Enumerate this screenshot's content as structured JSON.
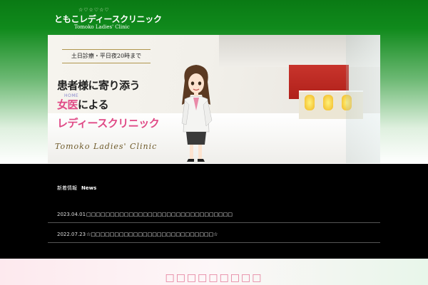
{
  "header": {
    "logo_main": "ともこレディースクリニック",
    "logo_sub": "Tomoko Ladies' Clinic",
    "logo_ornament": "☆♡☆♡☆♡"
  },
  "banner": {
    "badge": "土日診療・平日夜20時まで",
    "line1": "患者様に寄り添う",
    "line2_pink": "女医",
    "line2_rest": "による",
    "home_hint": "HOME",
    "line3": "レディースクリニック",
    "en_name": "Tomoko  Ladies'  Clinic"
  },
  "news": {
    "title_jp": "新着情報",
    "title_en": "News",
    "items": [
      {
        "date": "2023.04.01",
        "text": "□□□□□□□□□□□□□□□□□□□□□□□□□□□□□□□"
      },
      {
        "date": "2022.07.23",
        "text": "☆□□□□□□□□□□□□□□□□□□□□□□□□□□☆"
      }
    ]
  },
  "bottom": {
    "title": "□□□□□□□□□"
  },
  "colors": {
    "header_green": "#0a7a14",
    "accent_pink": "#e04a86",
    "news_bg": "#000000"
  }
}
